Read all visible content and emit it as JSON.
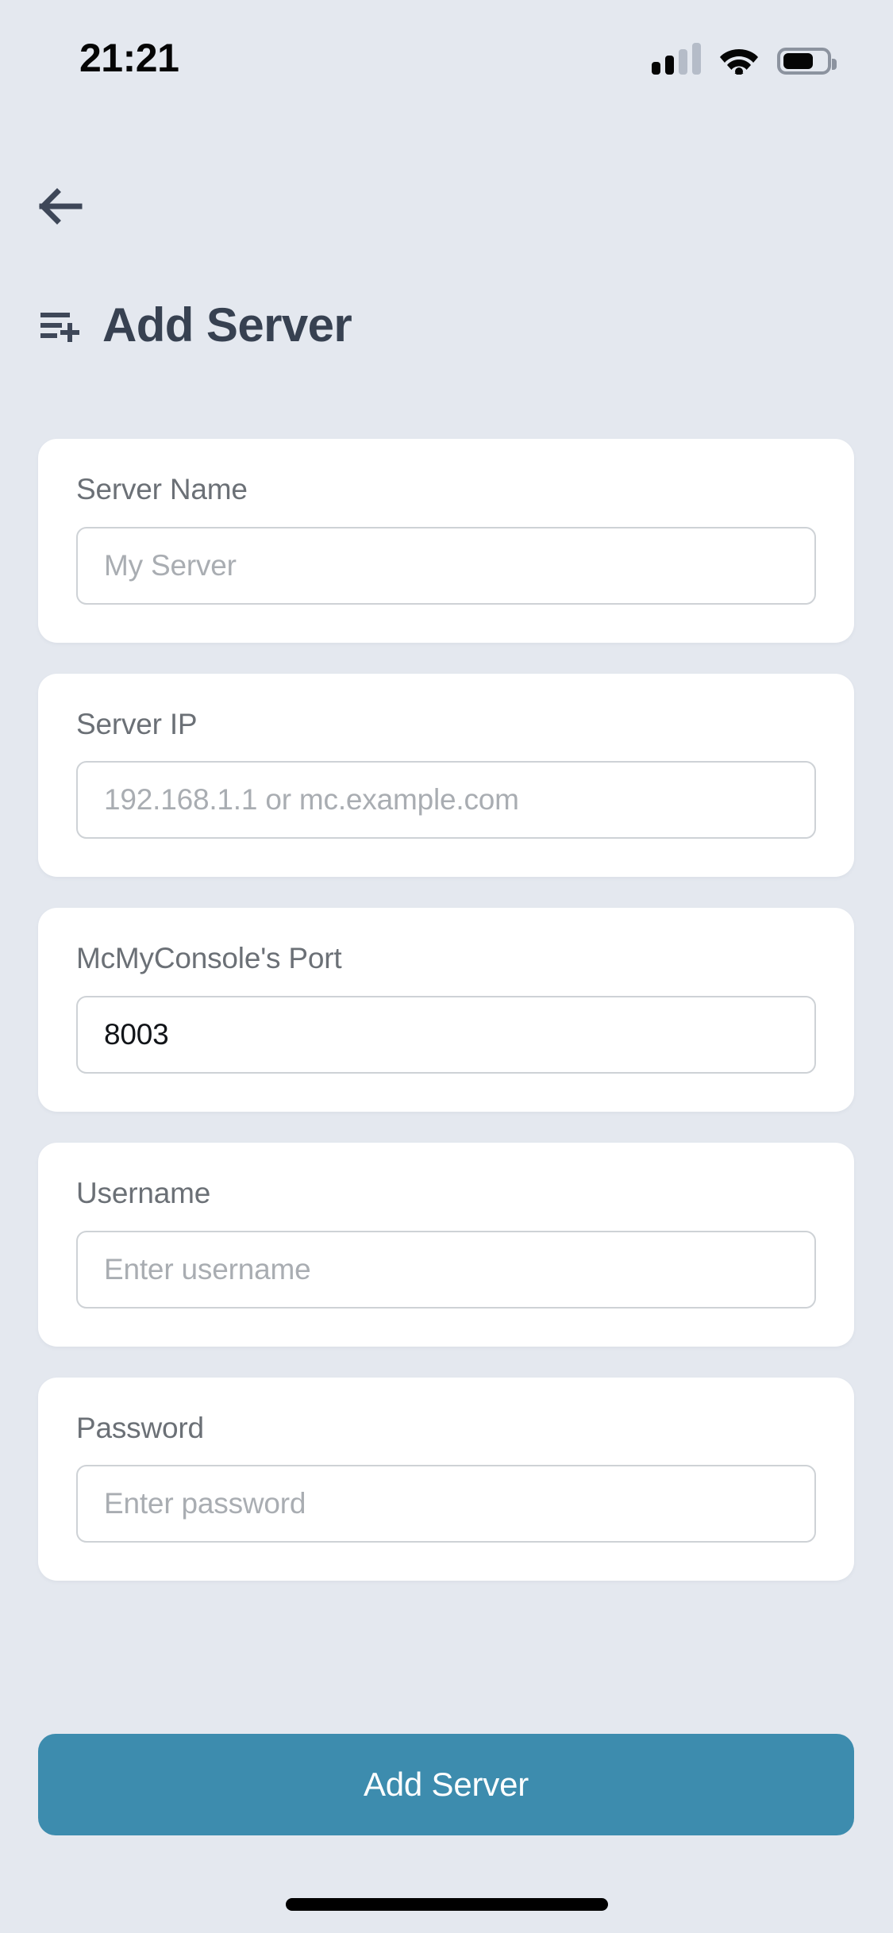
{
  "status_bar": {
    "time": "21:21",
    "signal_icon": "signal-bars-icon",
    "signal_bars_filled": 2,
    "signal_bars_total": 4,
    "wifi_icon": "wifi-icon",
    "battery_icon": "battery-icon",
    "battery_percent": 62
  },
  "nav": {
    "back_icon": "arrow-left-icon"
  },
  "header": {
    "icon": "list-plus-icon",
    "title": "Add Server"
  },
  "form": {
    "fields": [
      {
        "label": "Server Name",
        "placeholder": "My Server",
        "value": "",
        "type": "text"
      },
      {
        "label": "Server IP",
        "placeholder": "192.168.1.1 or mc.example.com",
        "value": "",
        "type": "text"
      },
      {
        "label": "McMyConsole's Port",
        "placeholder": "",
        "value": "8003",
        "type": "text"
      },
      {
        "label": "Username",
        "placeholder": "Enter username",
        "value": "",
        "type": "text"
      },
      {
        "label": "Password",
        "placeholder": "Enter password",
        "value": "",
        "type": "password"
      }
    ]
  },
  "actions": {
    "submit_label": "Add Server"
  },
  "colors": {
    "background": "#e4e8ef",
    "card": "#ffffff",
    "accent": "#3d8cae",
    "title_text": "#374151",
    "label_text": "#6b7076",
    "placeholder_text": "#a9adb2",
    "input_border": "#ced2d6",
    "value_text": "#111418"
  }
}
